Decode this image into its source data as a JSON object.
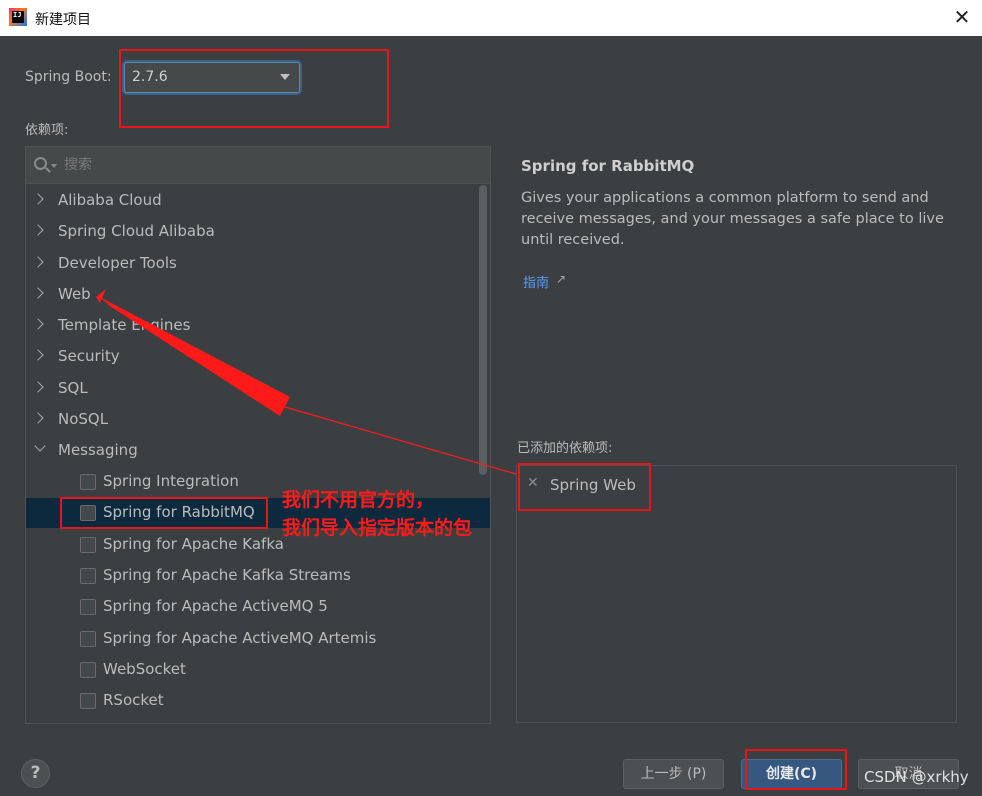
{
  "window": {
    "title": "新建项目",
    "app_icon_text": "IJ",
    "close_glyph": "✕"
  },
  "spring_boot": {
    "label": "Spring Boot:",
    "selected_version": "2.7.6"
  },
  "dependencies": {
    "label": "依赖项:",
    "search_placeholder": "搜索",
    "categories": [
      {
        "label": "Alibaba Cloud",
        "expanded": false
      },
      {
        "label": "Spring Cloud Alibaba",
        "expanded": false
      },
      {
        "label": "Developer Tools",
        "expanded": false
      },
      {
        "label": "Web",
        "expanded": false
      },
      {
        "label": "Template Engines",
        "expanded": false
      },
      {
        "label": "Security",
        "expanded": false
      },
      {
        "label": "SQL",
        "expanded": false
      },
      {
        "label": "NoSQL",
        "expanded": false
      },
      {
        "label": "Messaging",
        "expanded": true
      }
    ],
    "messaging_items": [
      {
        "label": "Spring Integration",
        "checked": false
      },
      {
        "label": "Spring for RabbitMQ",
        "checked": false,
        "selected": true
      },
      {
        "label": "Spring for Apache Kafka",
        "checked": false
      },
      {
        "label": "Spring for Apache Kafka Streams",
        "checked": false
      },
      {
        "label": "Spring for Apache ActiveMQ 5",
        "checked": false
      },
      {
        "label": "Spring for Apache ActiveMQ Artemis",
        "checked": false
      },
      {
        "label": "WebSocket",
        "checked": false
      },
      {
        "label": "RSocket",
        "checked": false
      }
    ]
  },
  "detail": {
    "title": "Spring for RabbitMQ",
    "description": "Gives your applications a common platform to send and receive messages, and your messages a safe place to live until received.",
    "guide_link": "指南",
    "guide_arrow": "↗"
  },
  "added": {
    "label": "已添加的依赖项:",
    "items": [
      {
        "label": "Spring Web"
      }
    ],
    "remove_glyph": "✕"
  },
  "footer": {
    "help_glyph": "?",
    "prev_label": "上一步 (P)",
    "create_label": "创建(C)",
    "cancel_label": "取消"
  },
  "annotation": {
    "line1": "我们不用官方的，",
    "line2": "我们导入指定版本的包",
    "color": "#e8161b"
  },
  "watermark": "CSDN @xrkhy",
  "colors": {
    "background": "#3c3f41",
    "selection": "#0d293e",
    "primary_button": "#365880",
    "link": "#589df6"
  }
}
